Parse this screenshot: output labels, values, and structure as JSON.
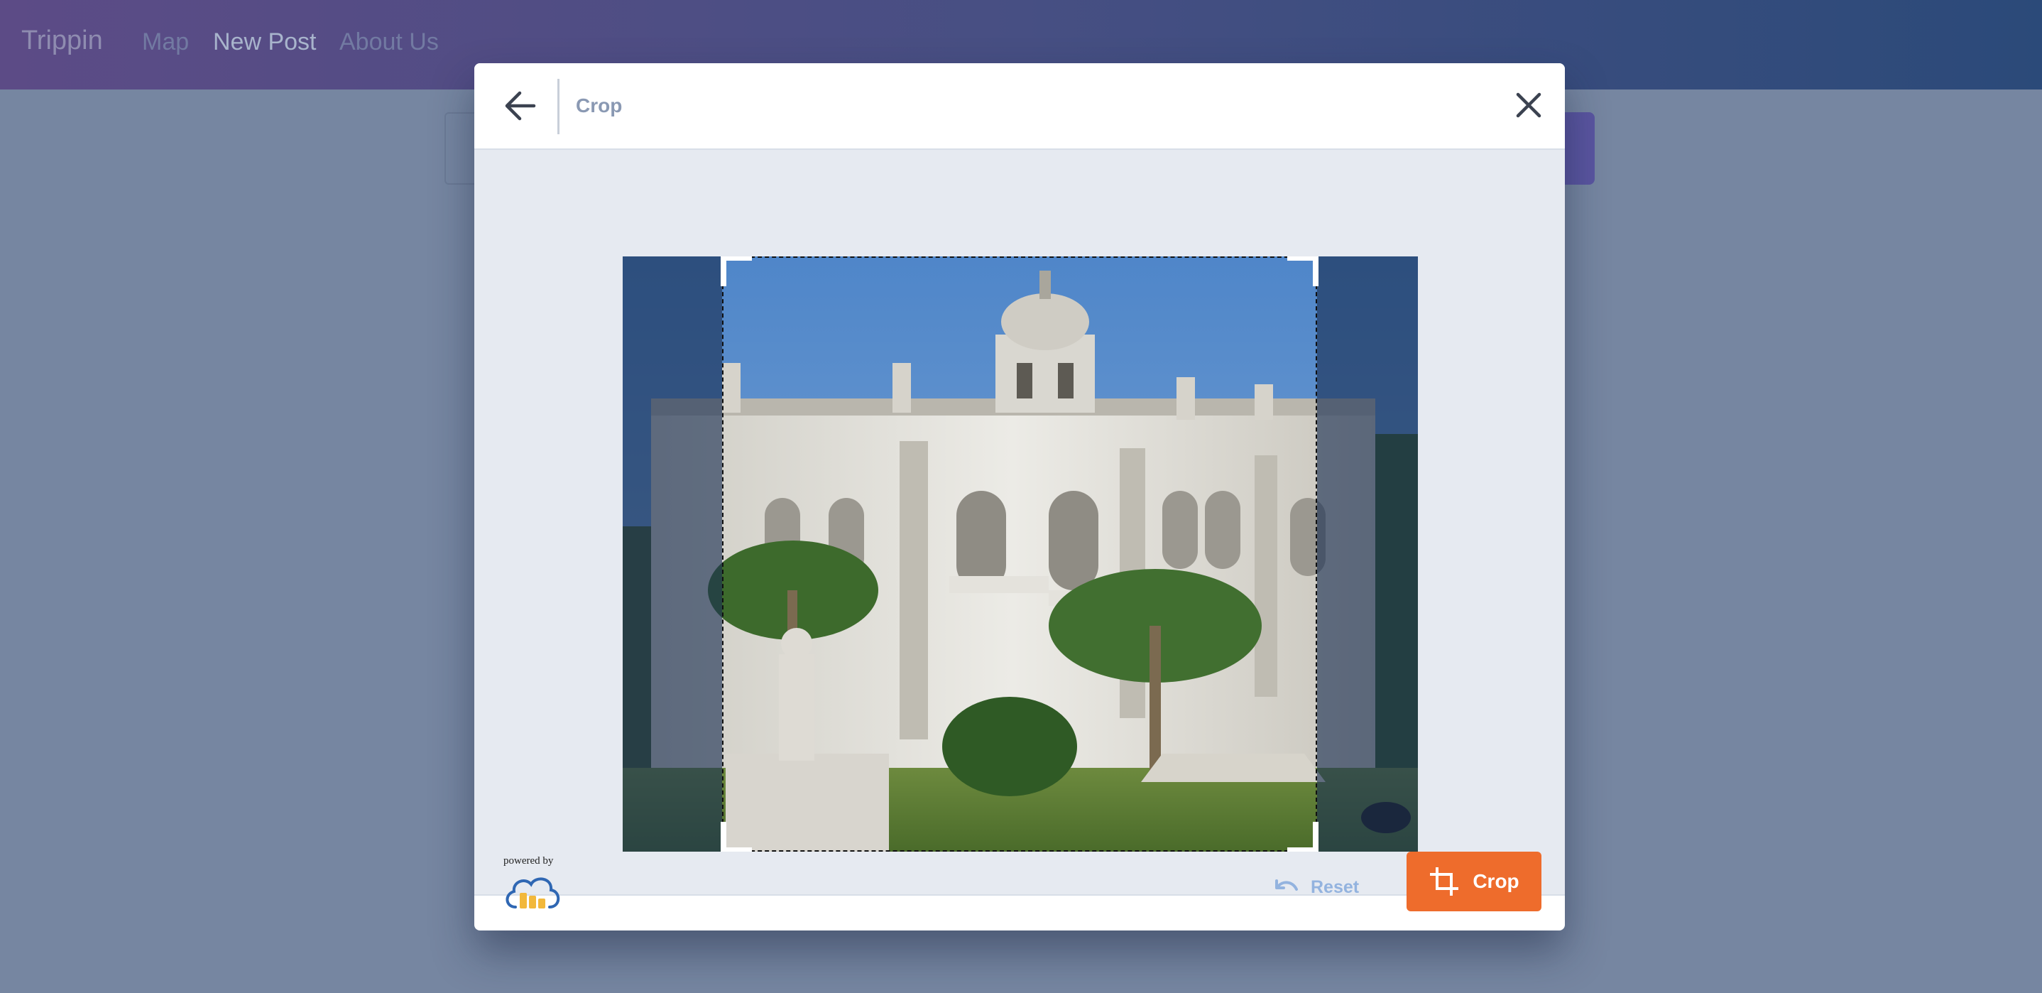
{
  "navbar": {
    "brand": "Trippin",
    "links": {
      "map": "Map",
      "new_post": "New Post",
      "about": "About Us"
    }
  },
  "modal": {
    "title": "Crop",
    "back_icon": "arrow-left-icon",
    "close_icon": "close-icon"
  },
  "footer": {
    "powered_by": "powered by",
    "logo": "cloudinary-logo",
    "reset_label": "Reset",
    "reset_icon": "undo-icon",
    "crop_label": "Crop",
    "crop_icon": "crop-icon"
  },
  "colors": {
    "accent_orange": "#ee6c2c",
    "reset_blue": "#93b3df",
    "overlay": "#7686a1",
    "modal_body": "#e6eaf1"
  }
}
